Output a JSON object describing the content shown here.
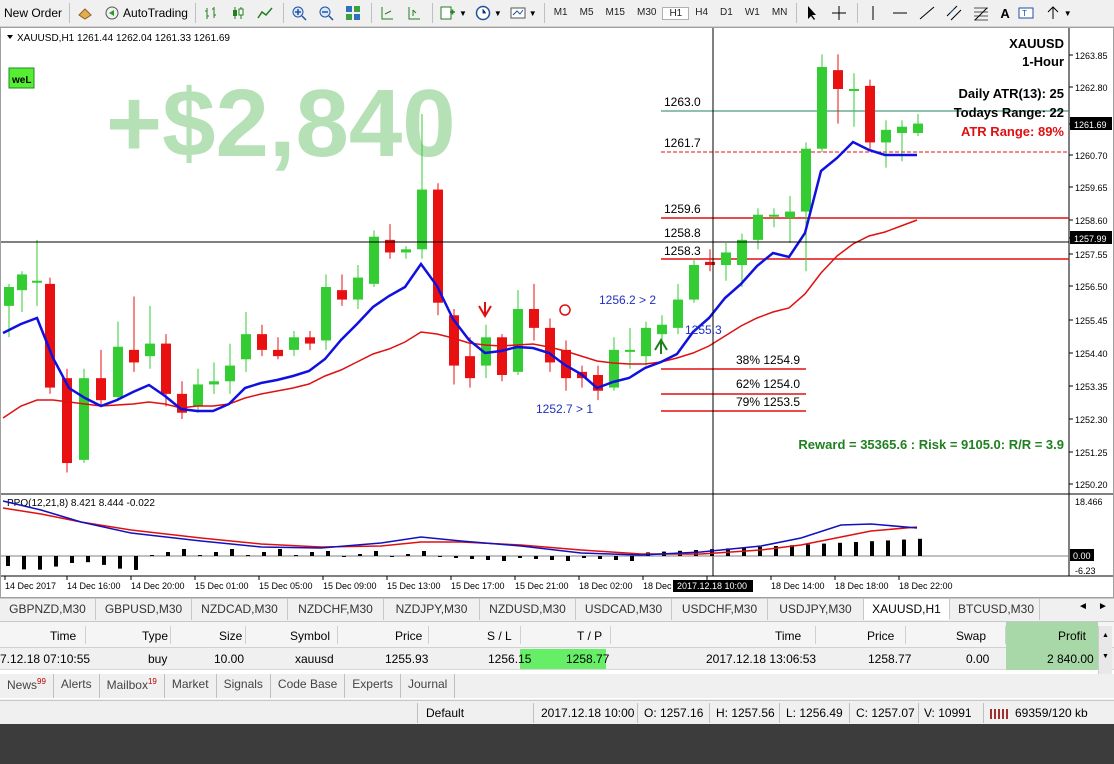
{
  "toolbar": {
    "new_order": "New Order",
    "auto_trading": "AutoTrading",
    "timeframes": [
      "M1",
      "M5",
      "M15",
      "M30",
      "H1",
      "H4",
      "D1",
      "W1",
      "MN"
    ]
  },
  "chart": {
    "header": "XAUUSD,H1  1261.44 1262.04 1261.33 1261.69",
    "profit_overlay": "+$2,840",
    "logo": "weL",
    "symbol": "XAUUSD",
    "period": "1-Hour",
    "daily_atr": "Daily ATR(13): 25",
    "todays_range": "Todays Range: 22",
    "atr_range": "ATR Range: 89%",
    "reward_risk": "Reward = 35365.6 : Risk = 9105.0: R/R = 3.9",
    "level_labels": [
      "1263.0",
      "1261.7",
      "1259.6",
      "1258.8",
      "1258.3"
    ],
    "fib_labels": [
      "38% 1254.9",
      "62% 1254.0",
      "79% 1253.5"
    ],
    "annotations": [
      "1256.2 > 2",
      "1252.7 > 1",
      "1255.3"
    ],
    "price_scale": [
      "1263.85",
      "1262.80",
      "1261.69",
      "1260.70",
      "1259.65",
      "1258.60",
      "1257.99",
      "1257.55",
      "1256.50",
      "1255.45",
      "1254.40",
      "1253.35",
      "1252.30",
      "1251.25",
      "1250.20"
    ],
    "current_price": "1261.69",
    "crosshair_price": "1257.99",
    "ppo_label": "PPO(12,21,8) 8.421 8.444 -0.022",
    "ppo_scale": [
      "18.466",
      "0.00",
      "-6.23"
    ],
    "time_labels": [
      "14 Dec 2017",
      "14 Dec 16:00",
      "14 Dec 20:00",
      "15 Dec 01:00",
      "15 Dec 05:00",
      "15 Dec 09:00",
      "15 Dec 13:00",
      "15 Dec 17:00",
      "15 Dec 21:00",
      "18 Dec 02:00",
      "18 Dec 06:00",
      "18 Dec 10:00",
      "18 Dec 14:00",
      "18 Dec 18:00",
      "18 Dec 22:00"
    ],
    "crosshair_time": "2017.12.18 10:00"
  },
  "symbol_tabs": [
    "GBPNZD,M30",
    "GBPUSD,M30",
    "NZDCAD,M30",
    "NZDCHF,M30",
    "NZDJPY,M30",
    "NZDUSD,M30",
    "USDCAD,M30",
    "USDCHF,M30",
    "USDJPY,M30",
    "XAUUSD,H1",
    "BTCUSD,M30"
  ],
  "terminal": {
    "headers": [
      "Time",
      "Type",
      "Size",
      "Symbol",
      "Price",
      "S / L",
      "T / P",
      "Time",
      "Price",
      "Swap",
      "Profit"
    ],
    "row": [
      "7.12.18 07:10:55",
      "buy",
      "10.00",
      "xauusd",
      "1255.93",
      "1256.15",
      "1258.77",
      "2017.12.18 13:06:53",
      "1258.77",
      "0.00",
      "2 840.00"
    ],
    "tabs": [
      {
        "label": "News",
        "badge": "99"
      },
      {
        "label": "Alerts",
        "badge": ""
      },
      {
        "label": "Mailbox",
        "badge": "19"
      },
      {
        "label": "Market",
        "badge": ""
      },
      {
        "label": "Signals",
        "badge": ""
      },
      {
        "label": "Code Base",
        "badge": ""
      },
      {
        "label": "Experts",
        "badge": ""
      },
      {
        "label": "Journal",
        "badge": ""
      }
    ]
  },
  "status": {
    "profile": "Default",
    "datetime": "2017.12.18 10:00",
    "open": "O: 1257.16",
    "high": "H: 1257.56",
    "low": "L: 1256.49",
    "close": "C: 1257.07",
    "volume": "V: 10991",
    "traffic": "69359/120 kb"
  },
  "colors": {
    "bull": "#33cc33",
    "bear": "#e81010",
    "fast_ma": "#1010e0",
    "slow_ma": "#e01010",
    "profit_overlay": "#b6e0b6",
    "reward": "#208020"
  }
}
